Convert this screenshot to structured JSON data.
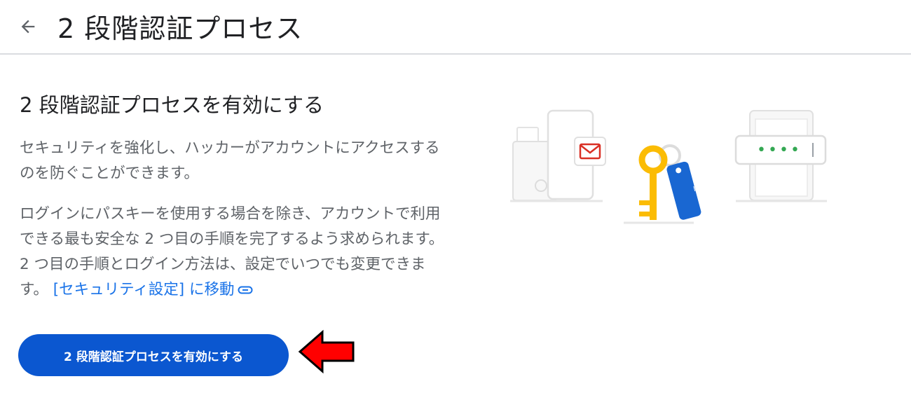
{
  "header": {
    "back_icon": "arrow-back-icon",
    "title": "2 段階認証プロセス"
  },
  "main": {
    "section_title": "2 段階認証プロセスを有効にする",
    "paragraph1": "セキュリティを強化し、ハッカーがアカウントにアクセスするのを防ぐことができます。",
    "paragraph2": "ログインにパスキーを使用する場合を除き、アカウントで利用できる最も安全な 2 つ目の手順を完了するよう求められます。2 つ目の手順とログイン方法は、設定でいつでも変更できます。",
    "link_label": "[セキュリティ設定] に移動",
    "link_icon": "link-icon",
    "enable_button_label": "2 段階認証プロセスを有効にする"
  },
  "illustration": {
    "icons": [
      "phone-icon",
      "mail-icon",
      "key-icon",
      "password-field-icon"
    ],
    "tag_text": "_**",
    "password_dots": "••••"
  },
  "annotation": {
    "icon": "red-arrow-icon",
    "color": "#ff0000"
  },
  "colors": {
    "accent": "#0b57d0",
    "link": "#1a73e8",
    "key_yellow": "#fbbc04",
    "tag_blue": "#1967d2",
    "mail_red": "#d93025",
    "dot_green": "#34a853"
  }
}
